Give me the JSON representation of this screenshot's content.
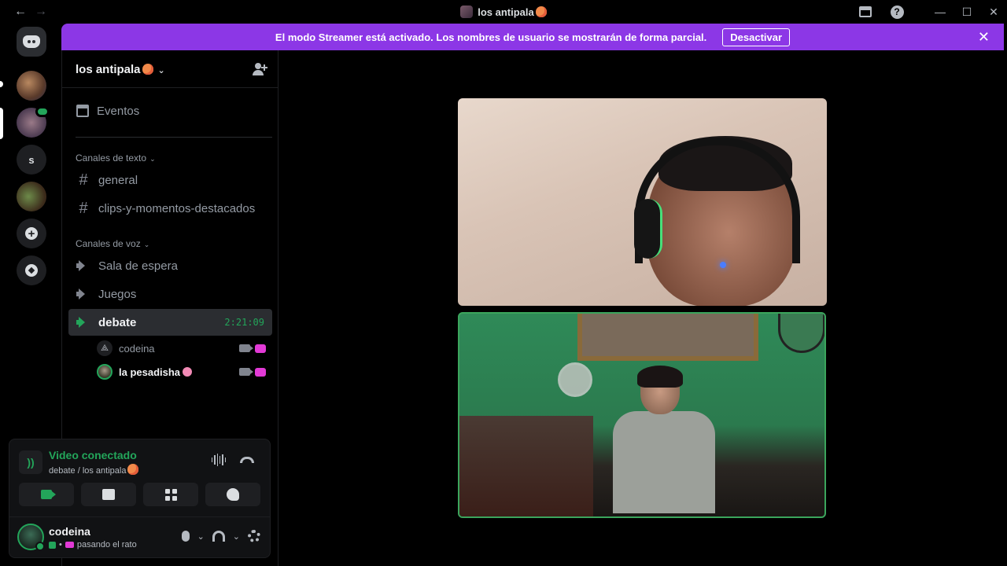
{
  "window": {
    "title": "los antipala",
    "back": "←",
    "forward": "→",
    "minimize": "—",
    "maximize": "☐",
    "close": "✕"
  },
  "banner": {
    "text": "El modo Streamer está activado. Los nombres de usuario se mostrarán de forma parcial.",
    "button": "Desactivar",
    "close": "✕",
    "color": "#8c37e6"
  },
  "rail": {
    "letter_server": "s"
  },
  "server": {
    "name": "los antipala",
    "events": "Eventos",
    "categories": {
      "text": "Canales de texto",
      "voice": "Canales de voz"
    },
    "text_channels": [
      "general",
      "clips-y-momentos-destacados"
    ],
    "voice_channels": [
      "Sala de espera",
      "Juegos",
      "debate"
    ],
    "active_voice_timer": "2:21:09",
    "voice_members": [
      {
        "name": "codeina"
      },
      {
        "name": "la pesadisha"
      }
    ]
  },
  "voice_panel": {
    "status": "Video conectado",
    "location": "debate / los antipala",
    "status_color": "#23a55a"
  },
  "user": {
    "name": "codeina",
    "activity": "pasando el rato"
  },
  "icons": {
    "hash": "#",
    "chevron": "⌄",
    "plus": "+",
    "signal": "))",
    "help": "?"
  }
}
